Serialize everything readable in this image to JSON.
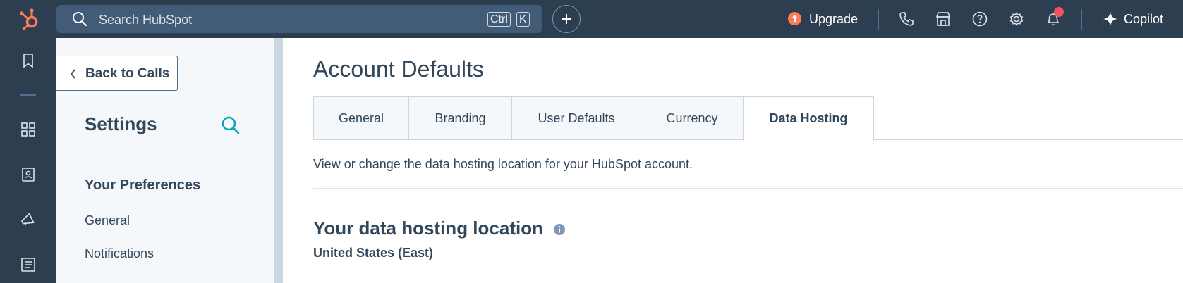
{
  "topbar": {
    "search_placeholder": "Search HubSpot",
    "shortcut_ctrl": "Ctrl",
    "shortcut_k": "K",
    "upgrade_label": "Upgrade",
    "copilot_label": "Copilot"
  },
  "settings_sidebar": {
    "back_label": "Back to Calls",
    "title": "Settings",
    "section_heading": "Your Preferences",
    "items": [
      {
        "label": "General"
      },
      {
        "label": "Notifications"
      }
    ]
  },
  "main": {
    "page_title": "Account Defaults",
    "tabs": [
      {
        "label": "General",
        "active": false
      },
      {
        "label": "Branding",
        "active": false
      },
      {
        "label": "User Defaults",
        "active": false
      },
      {
        "label": "Currency",
        "active": false
      },
      {
        "label": "Data Hosting",
        "active": true
      }
    ],
    "tab_description": "View or change the data hosting location for your HubSpot account.",
    "section_title": "Your data hosting location",
    "location_value": "United States (East)"
  },
  "colors": {
    "nav_bg": "#2d3e50",
    "search_bg": "#425b76",
    "upgrade_accent": "#ff7a59",
    "notification_dot": "#f2545b",
    "text_primary": "#33475b",
    "teal_accent": "#00a4bd"
  },
  "icons": {
    "logo": "hubspot-sprocket-icon",
    "search": "search-icon",
    "create": "plus-icon",
    "upgrade": "upgrade-arrow-icon",
    "calling": "phone-icon",
    "marketplace": "marketplace-icon",
    "help": "help-icon",
    "settings": "gear-icon",
    "notifications": "bell-icon",
    "copilot": "sparkle-icon",
    "nav": [
      "bookmark-icon",
      "apps-grid-icon",
      "contacts-icon",
      "marketing-megaphone-icon",
      "content-icon"
    ]
  }
}
